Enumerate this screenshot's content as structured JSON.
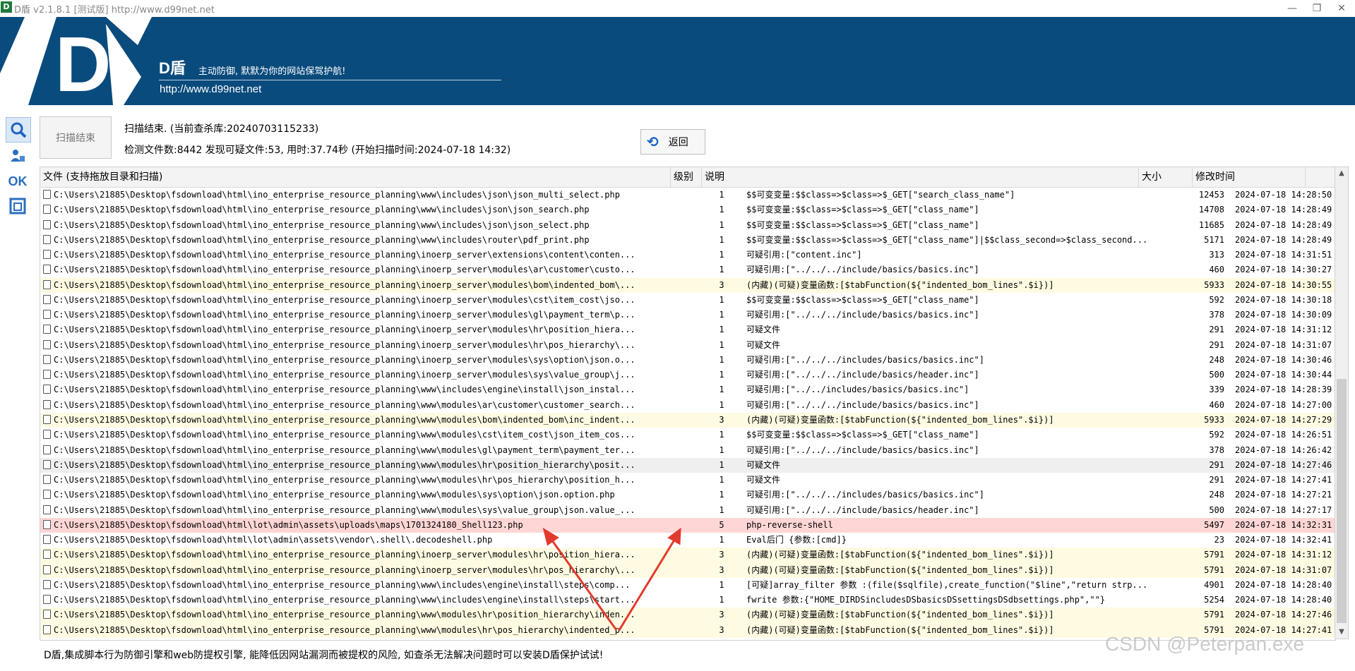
{
  "window": {
    "title": "D盾 v2.1.8.1 [测试版] http://www.d99net.net",
    "icon_text": "D",
    "controls": [
      "—",
      "❐",
      "✕"
    ]
  },
  "banner": {
    "logo_text": "D",
    "brand": "D盾",
    "tagline": "主动防御, 默默为你的网站保驾护航!",
    "url": "http://www.d99net.net",
    "background": "#0a4b7d"
  },
  "sidebar": {
    "ok_label": "OK"
  },
  "toolbar": {
    "scan_button": "扫描结束",
    "status_line1": "扫描结束. (当前查杀库:20240703115233)",
    "status_line2": "检测文件数:8442 发现可疑文件:53, 用时:37.74秒 (开始扫描时间:2024-07-18 14:32)",
    "back_button": "返回"
  },
  "grid": {
    "headers": {
      "file": "文件 (支持拖放目录和扫描)",
      "level": "级别",
      "desc": "说明",
      "size": "大小",
      "time": "修改时间"
    },
    "rows": [
      {
        "file": "C:\\Users\\21885\\Desktop\\fsdownload\\html\\ino_enterprise_resource_planning\\www\\includes\\json\\json_multi_select.php",
        "level": "1",
        "desc": "$$可变变量:$$class=>$class=>$_GET[\"search_class_name\"]",
        "size": "12453",
        "time": "2024-07-18 14:28:50",
        "hl": ""
      },
      {
        "file": "C:\\Users\\21885\\Desktop\\fsdownload\\html\\ino_enterprise_resource_planning\\www\\includes\\json\\json_search.php",
        "level": "1",
        "desc": "$$可变变量:$$class=>$class=>$_GET[\"class_name\"]",
        "size": "14708",
        "time": "2024-07-18 14:28:49",
        "hl": ""
      },
      {
        "file": "C:\\Users\\21885\\Desktop\\fsdownload\\html\\ino_enterprise_resource_planning\\www\\includes\\json\\json_select.php",
        "level": "1",
        "desc": "$$可变变量:$$class=>$class=>$_GET[\"class_name\"]",
        "size": "11685",
        "time": "2024-07-18 14:28:49",
        "hl": ""
      },
      {
        "file": "C:\\Users\\21885\\Desktop\\fsdownload\\html\\ino_enterprise_resource_planning\\www\\includes\\router\\pdf_print.php",
        "level": "1",
        "desc": "$$可变变量:$$class=>$class=>$_GET[\"class_name\"]|$$class_second=>$class_second...",
        "size": "5171",
        "time": "2024-07-18 14:28:49",
        "hl": ""
      },
      {
        "file": "C:\\Users\\21885\\Desktop\\fsdownload\\html\\ino_enterprise_resource_planning\\inoerp_server\\extensions\\content\\conten...",
        "level": "1",
        "desc": "可疑引用:[\"content.inc\"]",
        "size": "313",
        "time": "2024-07-18 14:31:51",
        "hl": ""
      },
      {
        "file": "C:\\Users\\21885\\Desktop\\fsdownload\\html\\ino_enterprise_resource_planning\\inoerp_server\\modules\\ar\\customer\\custo...",
        "level": "1",
        "desc": "可疑引用:[\"../../../include/basics/basics.inc\"]",
        "size": "460",
        "time": "2024-07-18 14:30:27",
        "hl": ""
      },
      {
        "file": "C:\\Users\\21885\\Desktop\\fsdownload\\html\\ino_enterprise_resource_planning\\inoerp_server\\modules\\bom\\indented_bom\\...",
        "level": "3",
        "desc": "(内藏)(可疑)变量函数:[$tabFunction(${\"indented_bom_lines\".$i})]",
        "size": "5933",
        "time": "2024-07-18 14:30:55",
        "hl": "lvl3"
      },
      {
        "file": "C:\\Users\\21885\\Desktop\\fsdownload\\html\\ino_enterprise_resource_planning\\inoerp_server\\modules\\cst\\item_cost\\jso...",
        "level": "1",
        "desc": "$$可变变量:$$class=>$class=>$_GET[\"class_name\"]",
        "size": "592",
        "time": "2024-07-18 14:30:18",
        "hl": ""
      },
      {
        "file": "C:\\Users\\21885\\Desktop\\fsdownload\\html\\ino_enterprise_resource_planning\\inoerp_server\\modules\\gl\\payment_term\\p...",
        "level": "1",
        "desc": "可疑引用:[\"../../../include/basics/basics.inc\"]",
        "size": "378",
        "time": "2024-07-18 14:30:09",
        "hl": ""
      },
      {
        "file": "C:\\Users\\21885\\Desktop\\fsdownload\\html\\ino_enterprise_resource_planning\\inoerp_server\\modules\\hr\\position_hiera...",
        "level": "1",
        "desc": "可疑文件",
        "size": "291",
        "time": "2024-07-18 14:31:12",
        "hl": ""
      },
      {
        "file": "C:\\Users\\21885\\Desktop\\fsdownload\\html\\ino_enterprise_resource_planning\\inoerp_server\\modules\\hr\\pos_hierarchy\\...",
        "level": "1",
        "desc": "可疑文件",
        "size": "291",
        "time": "2024-07-18 14:31:07",
        "hl": ""
      },
      {
        "file": "C:\\Users\\21885\\Desktop\\fsdownload\\html\\ino_enterprise_resource_planning\\inoerp_server\\modules\\sys\\option\\json.o...",
        "level": "1",
        "desc": "可疑引用:[\"../../../includes/basics/basics.inc\"]",
        "size": "248",
        "time": "2024-07-18 14:30:46",
        "hl": ""
      },
      {
        "file": "C:\\Users\\21885\\Desktop\\fsdownload\\html\\ino_enterprise_resource_planning\\inoerp_server\\modules\\sys\\value_group\\j...",
        "level": "1",
        "desc": "可疑引用:[\"../../../include/basics/header.inc\"]",
        "size": "500",
        "time": "2024-07-18 14:30:44",
        "hl": ""
      },
      {
        "file": "C:\\Users\\21885\\Desktop\\fsdownload\\html\\ino_enterprise_resource_planning\\www\\includes\\engine\\install\\json_instal...",
        "level": "1",
        "desc": "可疑引用:[\"../../includes/basics/basics.inc\"]",
        "size": "339",
        "time": "2024-07-18 14:28:39",
        "hl": ""
      },
      {
        "file": "C:\\Users\\21885\\Desktop\\fsdownload\\html\\ino_enterprise_resource_planning\\www\\modules\\ar\\customer\\customer_search...",
        "level": "1",
        "desc": "可疑引用:[\"../../../include/basics/basics.inc\"]",
        "size": "460",
        "time": "2024-07-18 14:27:00",
        "hl": ""
      },
      {
        "file": "C:\\Users\\21885\\Desktop\\fsdownload\\html\\ino_enterprise_resource_planning\\www\\modules\\bom\\indented_bom\\inc_indent...",
        "level": "3",
        "desc": "(内藏)(可疑)变量函数:[$tabFunction(${\"indented_bom_lines\".$i})]",
        "size": "5933",
        "time": "2024-07-18 14:27:29",
        "hl": "lvl3"
      },
      {
        "file": "C:\\Users\\21885\\Desktop\\fsdownload\\html\\ino_enterprise_resource_planning\\www\\modules\\cst\\item_cost\\json_item_cos...",
        "level": "1",
        "desc": "$$可变变量:$$class=>$class=>$_GET[\"class_name\"]",
        "size": "592",
        "time": "2024-07-18 14:26:51",
        "hl": ""
      },
      {
        "file": "C:\\Users\\21885\\Desktop\\fsdownload\\html\\ino_enterprise_resource_planning\\www\\modules\\gl\\payment_term\\payment_ter...",
        "level": "1",
        "desc": "可疑引用:[\"../../../include/basics/basics.inc\"]",
        "size": "378",
        "time": "2024-07-18 14:26:42",
        "hl": ""
      },
      {
        "file": "C:\\Users\\21885\\Desktop\\fsdownload\\html\\ino_enterprise_resource_planning\\www\\modules\\hr\\position_hierarchy\\posit...",
        "level": "1",
        "desc": "可疑文件",
        "size": "291",
        "time": "2024-07-18 14:27:46",
        "hl": "sel"
      },
      {
        "file": "C:\\Users\\21885\\Desktop\\fsdownload\\html\\ino_enterprise_resource_planning\\www\\modules\\hr\\pos_hierarchy\\position_h...",
        "level": "1",
        "desc": "可疑文件",
        "size": "291",
        "time": "2024-07-18 14:27:41",
        "hl": ""
      },
      {
        "file": "C:\\Users\\21885\\Desktop\\fsdownload\\html\\ino_enterprise_resource_planning\\www\\modules\\sys\\option\\json.option.php",
        "level": "1",
        "desc": "可疑引用:[\"../../../includes/basics/basics.inc\"]",
        "size": "248",
        "time": "2024-07-18 14:27:21",
        "hl": ""
      },
      {
        "file": "C:\\Users\\21885\\Desktop\\fsdownload\\html\\ino_enterprise_resource_planning\\www\\modules\\sys\\value_group\\json.value_...",
        "level": "1",
        "desc": "可疑引用:[\"../../../include/basics/header.inc\"]",
        "size": "500",
        "time": "2024-07-18 14:27:17",
        "hl": ""
      },
      {
        "file": "C:\\Users\\21885\\Desktop\\fsdownload\\html\\lot\\admin\\assets\\uploads\\maps\\1701324180_Shell123.php",
        "level": "5",
        "desc": "php-reverse-shell",
        "size": "5497",
        "time": "2024-07-18 14:32:31",
        "hl": "lvl5"
      },
      {
        "file": "C:\\Users\\21885\\Desktop\\fsdownload\\html\\lot\\admin\\assets\\vendor\\.shell\\.decodeshell.php",
        "level": "1",
        "desc": "Eval后门 {参数:[cmd]}",
        "size": "23",
        "time": "2024-07-18 14:32:41",
        "hl": ""
      },
      {
        "file": "C:\\Users\\21885\\Desktop\\fsdownload\\html\\ino_enterprise_resource_planning\\inoerp_server\\modules\\hr\\position_hiera...",
        "level": "3",
        "desc": "(内藏)(可疑)变量函数:[$tabFunction(${\"indented_bom_lines\".$i})]",
        "size": "5791",
        "time": "2024-07-18 14:31:12",
        "hl": "lvl3"
      },
      {
        "file": "C:\\Users\\21885\\Desktop\\fsdownload\\html\\ino_enterprise_resource_planning\\inoerp_server\\modules\\hr\\pos_hierarchy\\...",
        "level": "3",
        "desc": "(内藏)(可疑)变量函数:[$tabFunction(${\"indented_bom_lines\".$i})]",
        "size": "5791",
        "time": "2024-07-18 14:31:07",
        "hl": "lvl3"
      },
      {
        "file": "C:\\Users\\21885\\Desktop\\fsdownload\\html\\ino_enterprise_resource_planning\\www\\includes\\engine\\install\\steps\\comp...",
        "level": "1",
        "desc": "[可疑]array_filter 参数 :(file($sqlfile),create_function(\"$line\",\"return strp...",
        "size": "4901",
        "time": "2024-07-18 14:28:40",
        "hl": ""
      },
      {
        "file": "C:\\Users\\21885\\Desktop\\fsdownload\\html\\ino_enterprise_resource_planning\\www\\includes\\engine\\install\\steps\\start...",
        "level": "1",
        "desc": "fwrite 参数:{\"HOME_DIRDSincludesDSbasicsDSsettingsDSdbsettings.php\",\"\"}",
        "size": "5254",
        "time": "2024-07-18 14:28:40",
        "hl": ""
      },
      {
        "file": "C:\\Users\\21885\\Desktop\\fsdownload\\html\\ino_enterprise_resource_planning\\www\\modules\\hr\\position_hierarchy\\inden...",
        "level": "3",
        "desc": "(内藏)(可疑)变量函数:[$tabFunction(${\"indented_bom_lines\".$i})]",
        "size": "5791",
        "time": "2024-07-18 14:27:46",
        "hl": "lvl3"
      },
      {
        "file": "C:\\Users\\21885\\Desktop\\fsdownload\\html\\ino_enterprise_resource_planning\\www\\modules\\hr\\pos_hierarchy\\indented_p...",
        "level": "3",
        "desc": "(内藏)(可疑)变量函数:[$tabFunction(${\"indented_bom_lines\".$i})]",
        "size": "5791",
        "time": "2024-07-18 14:27:41",
        "hl": "lvl3"
      }
    ]
  },
  "footer": {
    "text": "D盾,集成脚本行为防御引擎和web防提权引擎, 能降低因网站漏洞而被提权的风险, 如查杀无法解决问题时可以安装D盾保护试试!"
  },
  "watermark": "CSDN @Peterpan.exe",
  "colors": {
    "level3_row": "#fffbe2",
    "level5_row": "#ffd6d6",
    "annotation_arrow": "#e23a2e"
  }
}
